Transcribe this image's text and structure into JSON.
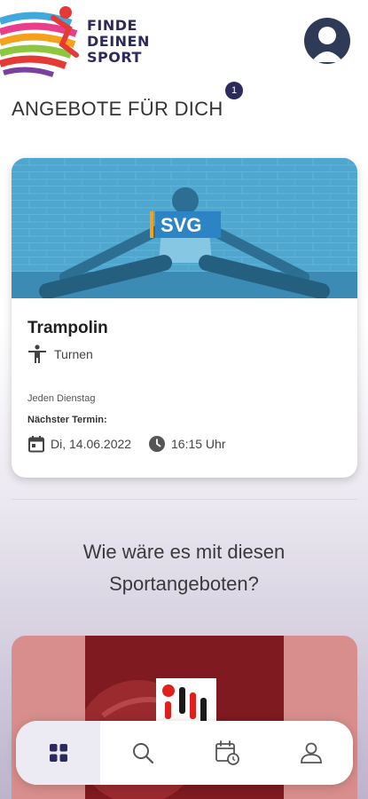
{
  "header": {
    "logo_line1": "FINDE",
    "logo_line2": "DEINEN",
    "logo_line3": "SPORT",
    "logo_icon": "runner-logo-icon",
    "avatar_icon": "user-avatar-icon"
  },
  "section": {
    "title": "ANGEBOTE FÜR DICH",
    "badge_count": "1"
  },
  "offer_card": {
    "title": "Trampolin",
    "category": "Turnen",
    "category_icon": "gymnast-icon",
    "schedule": "Jeden Dienstag",
    "next_label": "Nächster Termin:",
    "date": "Di, 14.06.2022",
    "date_icon": "calendar-icon",
    "time": "16:15 Uhr",
    "time_icon": "clock-icon",
    "image_logo": "SVG"
  },
  "suggestions": {
    "text": "Wie wäre es mit diesen Sportangeboten?"
  },
  "bottom_nav": {
    "items": [
      {
        "icon": "grid-icon",
        "active": true
      },
      {
        "icon": "search-icon",
        "active": false
      },
      {
        "icon": "calendar-badge-icon",
        "active": false
      },
      {
        "icon": "profile-icon",
        "active": false
      }
    ]
  },
  "colors": {
    "brand": "#2b2a5c",
    "card_image": "#4aa0c8",
    "second_card": "#d88e8c"
  }
}
